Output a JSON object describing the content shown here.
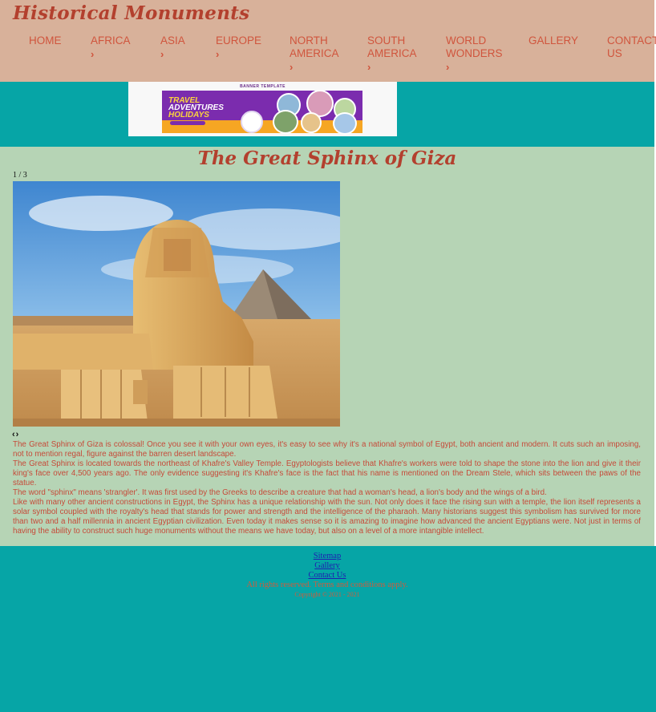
{
  "header": {
    "logo": "Historical Monuments",
    "nav": [
      {
        "label": "HOME",
        "dropdown": false
      },
      {
        "label": "AFRICA",
        "dropdown": true
      },
      {
        "label": "ASIA",
        "dropdown": true
      },
      {
        "label": "EUROPE",
        "dropdown": true
      },
      {
        "label": "NORTH AMERICA",
        "dropdown": true
      },
      {
        "label": "SOUTH AMERICA",
        "dropdown": true
      },
      {
        "label": "WORLD WONDERS",
        "dropdown": true
      },
      {
        "label": "GALLERY",
        "dropdown": false
      },
      {
        "label": "CONTACT US",
        "dropdown": false
      }
    ],
    "chevron": "›"
  },
  "banner": {
    "tag": "BANNER TEMPLATE",
    "line1": "TRAVEL",
    "line2": "ADVENTURES",
    "line3": "HOLIDAYS"
  },
  "main": {
    "title": "The Great Sphinx of Giza",
    "slide_counter": "1 / 3",
    "prev": "‹",
    "next": "›",
    "paragraphs": [
      "The Great Sphinx of Giza is colossal! Once you see it with your own eyes, it's easy to see why it's a national symbol of Egypt, both ancient and modern. It cuts such an imposing, not to mention regal, figure against the barren desert landscape.",
      "The Great Sphinx is located towards the northeast of Khafre's Valley Temple. Egyptologists believe that Khafre's workers were told to shape the stone into the lion and give it their king's face over 4,500 years ago. The only evidence suggesting it's Khafre's face is the fact that his name is mentioned on the Dream Stele, which sits between the paws of the statue.",
      "The word \"sphinx\" means 'strangler'. It was first used by the Greeks to describe a creature that had a woman's head, a lion's body and the wings of a bird.",
      "Like with many other ancient constructions in Egypt, the Sphinx has a unique relationship with the sun. Not only does it face the rising sun with a temple, the lion itself represents a solar symbol coupled with the royalty's head that stands for power and strength and the intelligence of the pharaoh. Many historians suggest this symbolism has survived for more than two and a half millennia in ancient Egyptian civilization. Even today it makes sense so it is amazing to imagine how advanced the ancient Egyptians were. Not just in terms of having the ability to construct such huge monuments without the means we have today, but also on a level of a more intangible intellect."
    ]
  },
  "footer": {
    "links": [
      "Sitemap",
      "Gallery",
      "Contact Us"
    ],
    "rights": "All rights reserved. Terms and conditions apply.",
    "copyright": "Copyright © 2021 - 2021"
  },
  "colors": {
    "header_bg": "#d8b19a",
    "page_bg": "#06a5a6",
    "content_bg": "#b6d4b5",
    "accent": "#b3402e",
    "nav_text": "#d0553d"
  }
}
